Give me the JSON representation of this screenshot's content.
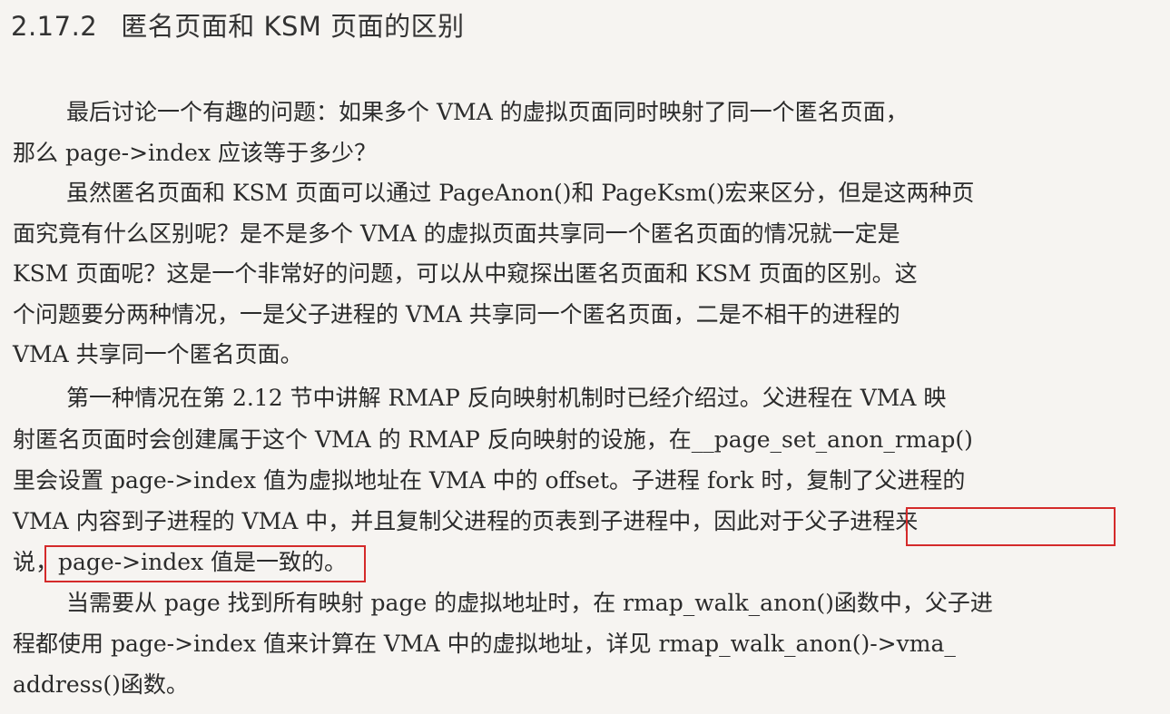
{
  "section": {
    "number": "2.17.2",
    "title": "匿名页面和 KSM 页面的区别"
  },
  "lines": [
    "最后讨论一个有趣的问题：如果多个 VMA 的虚拟页面同时映射了同一个匿名页面，",
    "那么 page->index 应该等于多少？",
    "虽然匿名页面和 KSM 页面可以通过 PageAnon()和 PageKsm()宏来区分，但是这两种页",
    "面究竟有什么区别呢？是不是多个 VMA 的虚拟页面共享同一个匿名页面的情况就一定是",
    "KSM 页面呢？这是一个非常好的问题，可以从中窥探出匿名页面和 KSM 页面的区别。这",
    "个问题要分两种情况，一是父子进程的 VMA 共享同一个匿名页面，二是不相干的进程的",
    "VMA 共享同一个匿名页面。",
    "第一种情况在第 2.12 节中讲解 RMAP 反向映射机制时已经介绍过。父进程在 VMA 映",
    "射匿名页面时会创建属于这个 VMA 的 RMAP 反向映射的设施，在__page_set_anon_rmap()",
    "里会设置 page->index 值为虚拟地址在 VMA 中的 offset。子进程 fork 时，复制了父进程的",
    "VMA 内容到子进程的 VMA 中，并且复制父进程的页表到子进程中，因此对于父子进程来",
    "说，page->index 值是一致的。",
    "当需要从 page 找到所有映射 page 的虚拟地址时，在 rmap_walk_anon()函数中，父子进",
    "程都使用 page->index 值来计算在 VMA 中的虚拟地址，详见 rmap_walk_anon()->vma_",
    "address()函数。"
  ],
  "highlight_color": "#d42a2a"
}
